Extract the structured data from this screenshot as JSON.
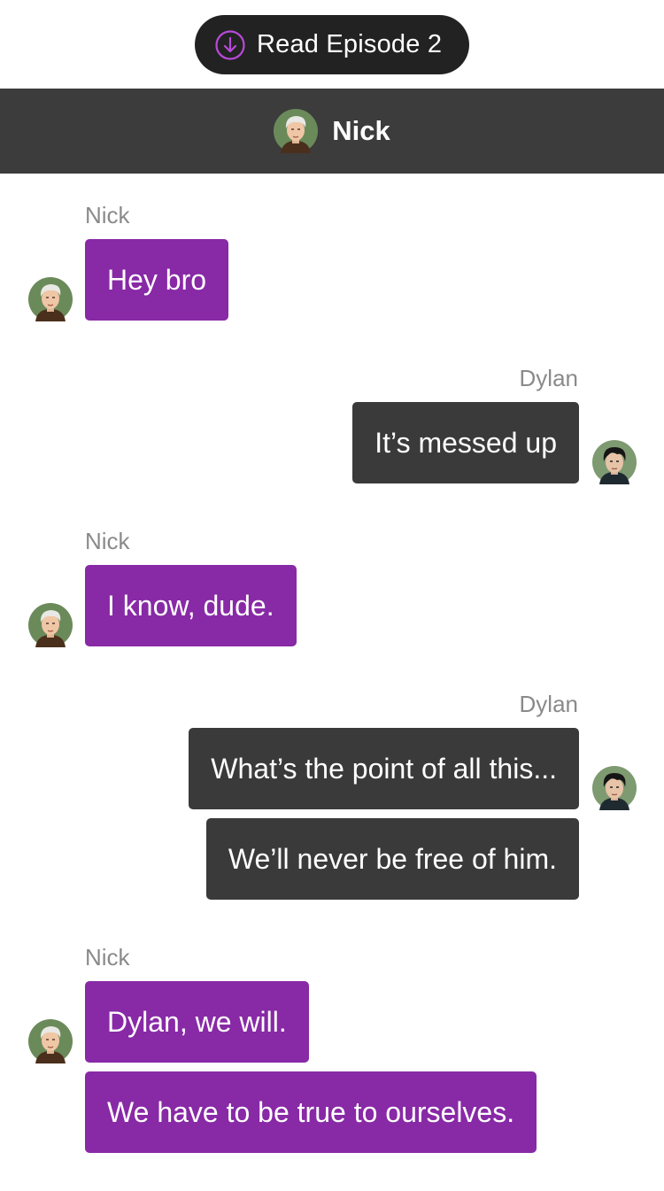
{
  "top_button": {
    "label": "Read Episode 2",
    "icon": "download-circle-icon"
  },
  "header": {
    "title": "Nick",
    "avatar": "nick-avatar"
  },
  "colors": {
    "nick_bubble": "#8829a6",
    "dylan_bubble": "#3a3a3a",
    "header_bg": "#3c3c3c",
    "accent": "#b84ad9"
  },
  "messages": [
    {
      "speaker": "Nick",
      "text": "Hey bro"
    },
    {
      "speaker": "Dylan",
      "text": "It’s messed up"
    },
    {
      "speaker": "Nick",
      "text": "I know, dude."
    },
    {
      "speaker": "Dylan",
      "text": "What’s the point of all this..."
    },
    {
      "speaker": "Dylan",
      "text": "We’ll never be free of him."
    },
    {
      "speaker": "Nick",
      "text": "Dylan, we will."
    },
    {
      "speaker": "Nick",
      "text": "We have to be true to ourselves."
    }
  ],
  "groups": [
    {
      "name": "Nick"
    },
    {
      "name": "Dylan"
    },
    {
      "name": "Nick"
    },
    {
      "name": "Dylan"
    },
    {
      "name": "Nick"
    }
  ]
}
